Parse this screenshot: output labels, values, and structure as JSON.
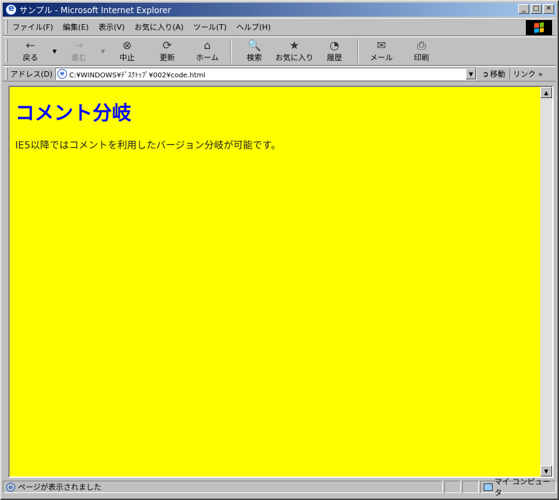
{
  "window": {
    "title": "サンプル - Microsoft Internet Explorer"
  },
  "title_buttons": {
    "minimize": "_",
    "maximize": "□",
    "close": "✕"
  },
  "menu": [
    "ファイル(F)",
    "編集(E)",
    "表示(V)",
    "お気に入り(A)",
    "ツール(T)",
    "ヘルプ(H)"
  ],
  "toolbar": {
    "back": {
      "label": "戻る",
      "icon": "←"
    },
    "forward": {
      "label": "進む",
      "icon": "→"
    },
    "stop": {
      "label": "中止",
      "icon": "⊗"
    },
    "refresh": {
      "label": "更新",
      "icon": "⟳"
    },
    "home": {
      "label": "ホーム",
      "icon": "⌂"
    },
    "search": {
      "label": "検索",
      "icon": "🔍"
    },
    "favorites": {
      "label": "お気に入り",
      "icon": "★"
    },
    "history": {
      "label": "履歴",
      "icon": "◔"
    },
    "mail": {
      "label": "メール",
      "icon": "✉"
    },
    "print": {
      "label": "印刷",
      "icon": "⎙"
    }
  },
  "address": {
    "label": "アドレス(D)",
    "value": "C:¥WINDOWS¥ﾃﾞｽｸﾄｯﾌﾟ¥002¥code.html",
    "go_label": "移動",
    "links_label": "リンク »"
  },
  "page": {
    "heading": "コメント分岐",
    "paragraph": "IE5以降ではコメントを利用したバージョン分岐が可能です。",
    "background": "#ffff00",
    "heading_color": "#0000ff"
  },
  "status": {
    "text": "ページが表示されました",
    "zone": "マイ コンピュータ"
  }
}
